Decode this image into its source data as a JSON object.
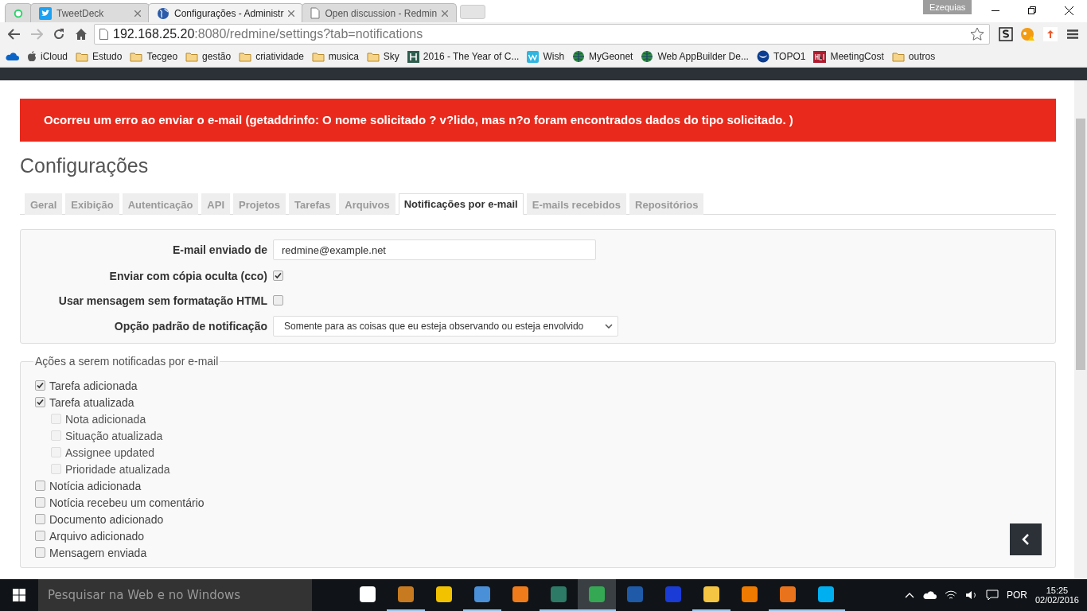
{
  "browser": {
    "profile": "Ezequias",
    "tabs": [
      {
        "kind": "pinned",
        "selected": false
      },
      {
        "kind": "normal",
        "title": "TweetDeck",
        "selected": false
      },
      {
        "kind": "normal",
        "title": "Configurações - Administr",
        "selected": true
      },
      {
        "kind": "normal",
        "title": "Open discussion - Redmin",
        "selected": false
      }
    ],
    "address": {
      "host": "192.168.25.20",
      "rest": ":8080/redmine/settings?tab=notifications"
    },
    "bookmarks": [
      {
        "kind": "cloud"
      },
      {
        "kind": "apple",
        "label": "iCloud"
      },
      {
        "kind": "folder",
        "label": "Estudo"
      },
      {
        "kind": "folder",
        "label": "Tecgeo"
      },
      {
        "kind": "folder",
        "label": "gestão"
      },
      {
        "kind": "folder",
        "label": "criatividade"
      },
      {
        "kind": "folder",
        "label": "musica"
      },
      {
        "kind": "folder",
        "label": "Sky"
      },
      {
        "kind": "h",
        "label": "2016 - The Year of C..."
      },
      {
        "kind": "w",
        "label": "Wish"
      },
      {
        "kind": "globe",
        "label": "MyGeonet"
      },
      {
        "kind": "globe",
        "label": "Web AppBuilder De..."
      },
      {
        "kind": "noaa",
        "label": "TOPO1"
      },
      {
        "kind": "hbr",
        "label": "MeetingCost"
      },
      {
        "kind": "folder",
        "label": "outros"
      }
    ]
  },
  "page": {
    "error": "Ocorreu um erro ao enviar o e-mail (getaddrinfo: O nome solicitado ? v?lido, mas n?o foram encontrados dados do tipo solicitado. )",
    "title": "Configurações",
    "tabs": [
      {
        "label": "Geral",
        "selected": false
      },
      {
        "label": "Exibição",
        "selected": false
      },
      {
        "label": "Autenticação",
        "selected": false
      },
      {
        "label": "API",
        "selected": false
      },
      {
        "label": "Projetos",
        "selected": false
      },
      {
        "label": "Tarefas",
        "selected": false
      },
      {
        "label": "Arquivos",
        "selected": false
      },
      {
        "label": "Notificações por e-mail",
        "selected": true
      },
      {
        "label": "E-mails recebidos",
        "selected": false
      },
      {
        "label": "Repositórios",
        "selected": false
      }
    ],
    "settings": [
      {
        "kind": "text",
        "label": "E-mail enviado de",
        "value": "redmine@example.net"
      },
      {
        "kind": "checkbox",
        "label": "Enviar com cópia oculta (cco)",
        "checked": true
      },
      {
        "kind": "checkbox",
        "label": "Usar mensagem sem formatação HTML",
        "checked": false
      },
      {
        "kind": "select",
        "label": "Opção padrão de notificação",
        "value": "Somente para as coisas que eu esteja observando ou esteja envolvido"
      }
    ],
    "actions": {
      "legend": "Ações a serem notificadas por e-mail",
      "items": [
        {
          "label": "Tarefa adicionada",
          "checked": true,
          "disabled": false
        },
        {
          "label": "Tarefa atualizada",
          "checked": true,
          "disabled": false,
          "children": [
            {
              "label": "Nota adicionada",
              "checked": false,
              "disabled": true
            },
            {
              "label": "Situação atualizada",
              "checked": false,
              "disabled": true
            },
            {
              "label": "Assignee updated",
              "checked": false,
              "disabled": true
            },
            {
              "label": "Prioridade atualizada",
              "checked": false,
              "disabled": true
            }
          ]
        },
        {
          "label": "Notícia adicionada",
          "checked": false,
          "disabled": false
        },
        {
          "label": "Notícia recebeu um comentário",
          "checked": false,
          "disabled": false
        },
        {
          "label": "Documento adicionado",
          "checked": false,
          "disabled": false
        },
        {
          "label": "Arquivo adicionado",
          "checked": false,
          "disabled": false
        },
        {
          "label": "Mensagem enviada",
          "checked": false,
          "disabled": false
        }
      ]
    }
  },
  "taskbar": {
    "search": {
      "placeholder": "Pesquisar na Web e no Windows"
    },
    "apps": [
      {
        "color": "#ffffff",
        "running": false,
        "selected": false
      },
      {
        "color": "#c77a20",
        "running": true,
        "selected": false
      },
      {
        "color": "#f2c200",
        "running": false,
        "selected": false
      },
      {
        "color": "#4a90d9",
        "running": true,
        "selected": false
      },
      {
        "color": "#f07b1b",
        "running": false,
        "selected": false
      },
      {
        "color": "#2d7a66",
        "running": true,
        "selected": false
      },
      {
        "color": "#34a853",
        "running": true,
        "selected": true
      },
      {
        "color": "#1e5aa8",
        "running": false,
        "selected": false
      },
      {
        "color": "#1a3bd6",
        "running": false,
        "selected": false
      },
      {
        "color": "#f4c542",
        "running": true,
        "selected": false
      },
      {
        "color": "#ee7a00",
        "running": false,
        "selected": false
      },
      {
        "color": "#e8731c",
        "running": true,
        "selected": false
      },
      {
        "color": "#00aff0",
        "running": true,
        "selected": false
      }
    ],
    "language": "POR",
    "time": "15:25",
    "date": "02/02/2016"
  }
}
